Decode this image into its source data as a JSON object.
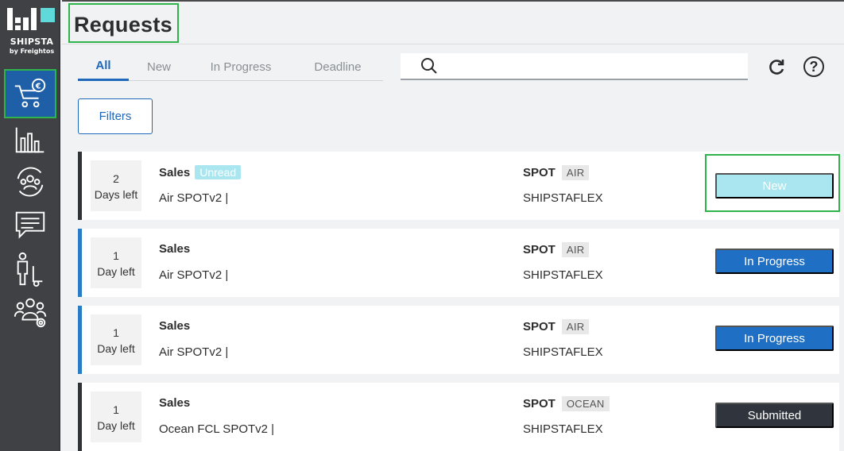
{
  "brand": {
    "name": "SHIPSTA",
    "tagline": "by Freightos"
  },
  "sidebar": {
    "items": [
      {
        "name": "requests",
        "icon": "cart-euro-icon",
        "active": true
      },
      {
        "name": "analytics",
        "icon": "bar-chart-icon"
      },
      {
        "name": "partners",
        "icon": "people-circle-icon"
      },
      {
        "name": "messages",
        "icon": "chat-icon"
      },
      {
        "name": "shipments",
        "icon": "person-cart-icon"
      },
      {
        "name": "team-settings",
        "icon": "team-gear-icon"
      }
    ]
  },
  "header": {
    "title": "Requests"
  },
  "tabs": [
    {
      "label": "All",
      "active": true
    },
    {
      "label": "New"
    },
    {
      "label": "In Progress"
    },
    {
      "label": "Deadline"
    }
  ],
  "search": {
    "placeholder": "",
    "value": ""
  },
  "toolbar": {
    "help_label": "?"
  },
  "filters": {
    "label": "Filters"
  },
  "requests": [
    {
      "days_num": "2",
      "days_label": "Days left",
      "title": "Sales",
      "badge": "Unread",
      "subtitle": "Air SPOTv2 |",
      "type": "SPOT",
      "mode": "AIR",
      "carrier": "SHIPSTAFLEX",
      "status": "New"
    },
    {
      "days_num": "1",
      "days_label": "Day left",
      "title": "Sales",
      "badge": "",
      "subtitle": "Air SPOTv2 |",
      "type": "SPOT",
      "mode": "AIR",
      "carrier": "SHIPSTAFLEX",
      "status": "In Progress"
    },
    {
      "days_num": "1",
      "days_label": "Day left",
      "title": "Sales",
      "badge": "",
      "subtitle": "Air SPOTv2 |",
      "type": "SPOT",
      "mode": "AIR",
      "carrier": "SHIPSTAFLEX",
      "status": "In Progress"
    },
    {
      "days_num": "1",
      "days_label": "Day left",
      "title": "Sales",
      "badge": "",
      "subtitle": "Ocean FCL SPOTv2 |",
      "type": "SPOT",
      "mode": "OCEAN",
      "carrier": "SHIPSTAFLEX",
      "status": "Submitted"
    }
  ],
  "colors": {
    "accent": "#1f67b8",
    "highlight": "#2fb34b",
    "sidebar": "#3f4145",
    "new_status": "#a9e6f0",
    "progress_status": "#1f6fc4",
    "submitted_status": "#30353d"
  }
}
